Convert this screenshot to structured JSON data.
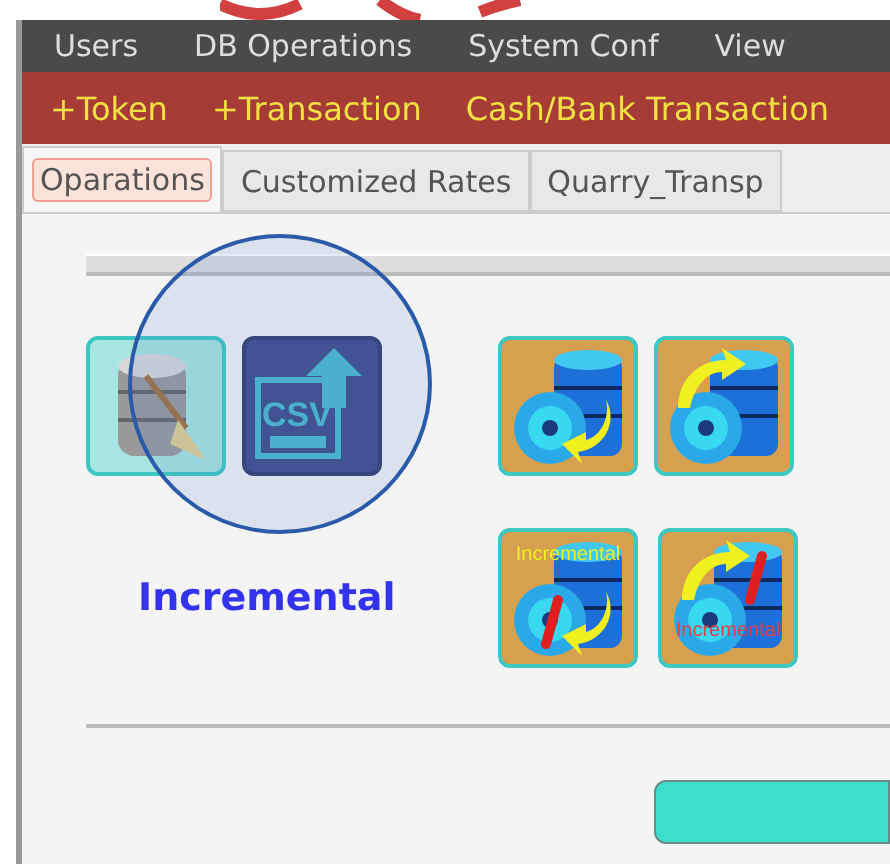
{
  "menu_bar": [
    "Users",
    "DB Operations",
    "System Conf",
    "View"
  ],
  "toolbar": [
    "+Token",
    "+Transaction",
    "Cash/Bank Transaction"
  ],
  "tabs": [
    {
      "label": "Oparations",
      "selected": true
    },
    {
      "label": "Customized Rates",
      "selected": false
    },
    {
      "label": "Quarry_Transp",
      "selected": false
    }
  ],
  "row_1": [
    {
      "kind": "db-clean"
    },
    {
      "kind": "csv-upload",
      "label": "CSV"
    },
    {
      "kind": "backup"
    },
    {
      "kind": "restore"
    }
  ],
  "incremental_label": "Incremental",
  "row_2": [
    {
      "kind": "backup-incremental",
      "label": "Incremental"
    },
    {
      "kind": "restore-incremental",
      "label": "Incremental"
    }
  ]
}
